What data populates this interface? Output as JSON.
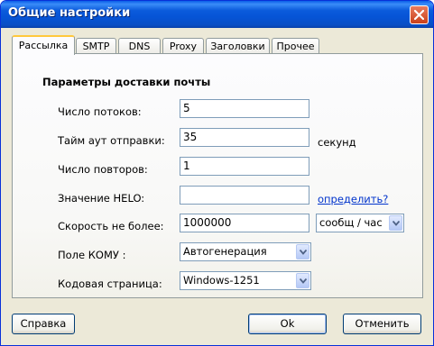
{
  "window": {
    "title": "Общие настройки"
  },
  "tabs": [
    {
      "label": "Рассылка",
      "active": true
    },
    {
      "label": "SMTP"
    },
    {
      "label": "DNS"
    },
    {
      "label": "Proxy"
    },
    {
      "label": "Заголовки"
    },
    {
      "label": "Прочее"
    }
  ],
  "section": {
    "title": "Параметры доставки почты"
  },
  "fields": {
    "threads": {
      "label": "Число потоков:",
      "value": "5"
    },
    "timeout": {
      "label": "Тайм аут отправки:",
      "value": "35",
      "unit": "секунд"
    },
    "retries": {
      "label": "Число повторов:",
      "value": "1"
    },
    "helo": {
      "label": "Значение HELO:",
      "value": "",
      "link": "определить?"
    },
    "speed": {
      "label": "Скорость не более:",
      "value": "1000000",
      "unit_selected": "сообщ / час"
    },
    "to": {
      "label": "Поле КОМУ :",
      "selected": "Автогенерация"
    },
    "codepage": {
      "label": "Кодовая страница:",
      "selected": "Windows-1251"
    }
  },
  "buttons": {
    "help": "Справка",
    "ok": "Ok",
    "cancel": "Отменить"
  },
  "colors": {
    "title_bar": "#0654d6",
    "close_button": "#d9532c",
    "link": "#0033cc",
    "active_tab_accent": "#ffc83c"
  },
  "icons": {
    "close": "close-icon",
    "dropdown": "chevron-down-icon"
  }
}
